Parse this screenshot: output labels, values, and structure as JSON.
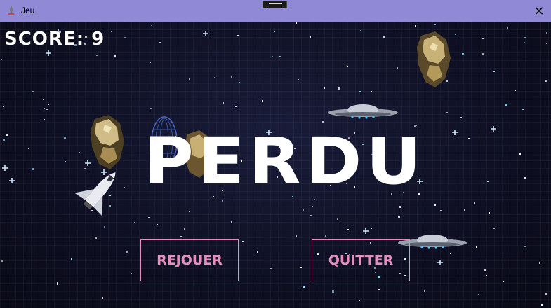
{
  "window": {
    "title": "Jeu",
    "close_glyph": "✕"
  },
  "hud": {
    "score_text": "SCORE: 9"
  },
  "game_over": {
    "title": "PERDU"
  },
  "buttons": {
    "replay": "REJOUER",
    "quit": "QUITTER"
  },
  "colors": {
    "titlebar": "#8f89d6",
    "background": "#101020",
    "button_accent": "#e58ebc",
    "text": "#ffffff"
  },
  "icons": [
    "app-icon",
    "close-icon",
    "drag-handle-icon",
    "asteroid-icon",
    "ufo-icon",
    "space-shuttle-icon",
    "portal-icon"
  ]
}
